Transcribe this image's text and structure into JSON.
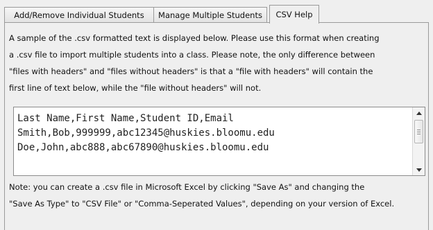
{
  "tabs": [
    {
      "label": "Add/Remove Individual Students",
      "active": false
    },
    {
      "label": "Manage Multiple Students",
      "active": false
    },
    {
      "label": "CSV Help",
      "active": true
    }
  ],
  "intro_lines": [
    "A sample of the .csv formatted text is displayed below.  Please use this format when creating",
    "a .csv file to import multiple students into a class. Please note, the only difference between",
    "\"files with headers\" and \"files without headers\" is that a \"file with headers\" will contain the",
    "first line of text below, while the \"file without headers\" will not."
  ],
  "csv_sample_lines": [
    "Last Name,First Name,Student ID,Email",
    "Smith,Bob,999999,abc12345@huskies.bloomu.edu",
    "Doe,John,abc888,abc67890@huskies.bloomu.edu"
  ],
  "note_lines": [
    "Note: you can create a .csv file in Microsoft Excel by clicking \"Save As\" and changing the",
    "\"Save As Type\" to \"CSV File\" or \"Comma-Seperated Values\", depending on your version of Excel."
  ],
  "icons": {
    "scroll_up": "up-arrow-icon",
    "scroll_down": "down-arrow-icon"
  }
}
